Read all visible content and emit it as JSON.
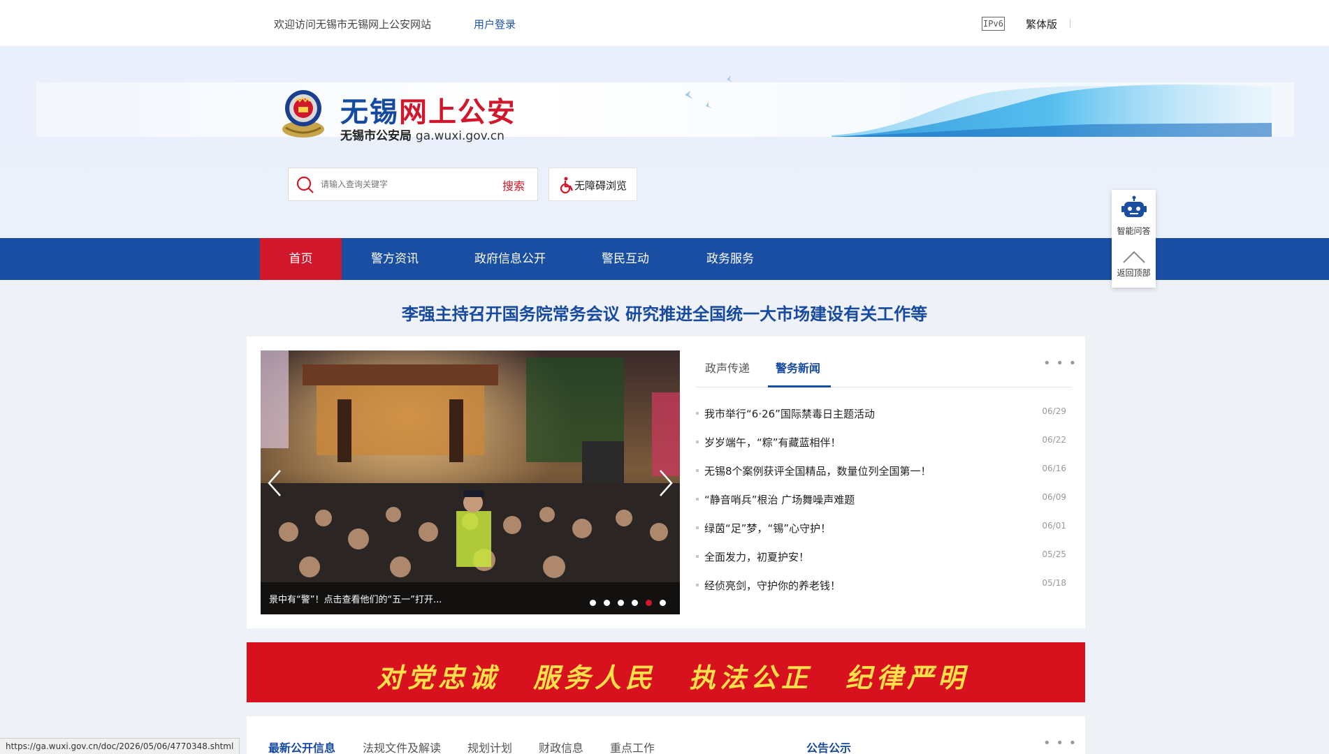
{
  "topbar": {
    "welcome": "欢迎访问无锡市无锡网上公安网站",
    "login": "用户登录",
    "ipv6": "IPv6",
    "traditional": "繁体版"
  },
  "header": {
    "title_part1": "无锡",
    "title_part2": "网上公安",
    "subtitle": "无锡市公安局",
    "domain": "ga.wuxi.gov.cn"
  },
  "search": {
    "placeholder": "请输入查询关键字",
    "button": "搜索",
    "accessibility": "无障碍浏览"
  },
  "nav": {
    "items": [
      {
        "label": "首页"
      },
      {
        "label": "警方资讯"
      },
      {
        "label": "政府信息公开"
      },
      {
        "label": "警民互动"
      },
      {
        "label": "政务服务"
      }
    ]
  },
  "floatbar": {
    "qa": "智能问答",
    "top": "返回顶部"
  },
  "headline": "李强主持召开国务院常务会议 研究推进全国统一大市场建设有关工作等",
  "slider": {
    "caption": "景中有“警”！点击查看他们的“五一”打开...",
    "slide_count": 6,
    "active_slide": 5
  },
  "news_tabs": [
    {
      "label": "政声传递"
    },
    {
      "label": "警务新闻"
    }
  ],
  "more": "• • •",
  "news": [
    {
      "title": "我市举行“6·26”国际禁毒日主题活动",
      "date": "06/29"
    },
    {
      "title": "岁岁端午，“粽”有藏蓝相伴！",
      "date": "06/22"
    },
    {
      "title": "无锡8个案例获评全国精品，数量位列全国第一！",
      "date": "06/16"
    },
    {
      "title": "“静音哨兵”根治 广场舞噪声难题",
      "date": "06/09"
    },
    {
      "title": "绿茵“足”梦，“锡”心守护！",
      "date": "06/01"
    },
    {
      "title": "全面发力，初夏护安！",
      "date": "05/25"
    },
    {
      "title": "经侦亮剑，守护你的养老钱！",
      "date": "05/18"
    }
  ],
  "motto": [
    "对党忠诚",
    "服务人民",
    "执法公正",
    "纪律严明"
  ],
  "lower_tabs": [
    {
      "label": "最新公开信息"
    },
    {
      "label": "法规文件及解读"
    },
    {
      "label": "规划计划"
    },
    {
      "label": "财政信息"
    },
    {
      "label": "重点工作"
    }
  ],
  "announce": "公告公示",
  "status_url": "https://ga.wuxi.gov.cn/doc/2026/05/06/4770348.shtml",
  "colors": {
    "brand_blue": "#1a4ea3",
    "brand_red": "#d0172b",
    "motto_yellow": "#ffe04a"
  }
}
